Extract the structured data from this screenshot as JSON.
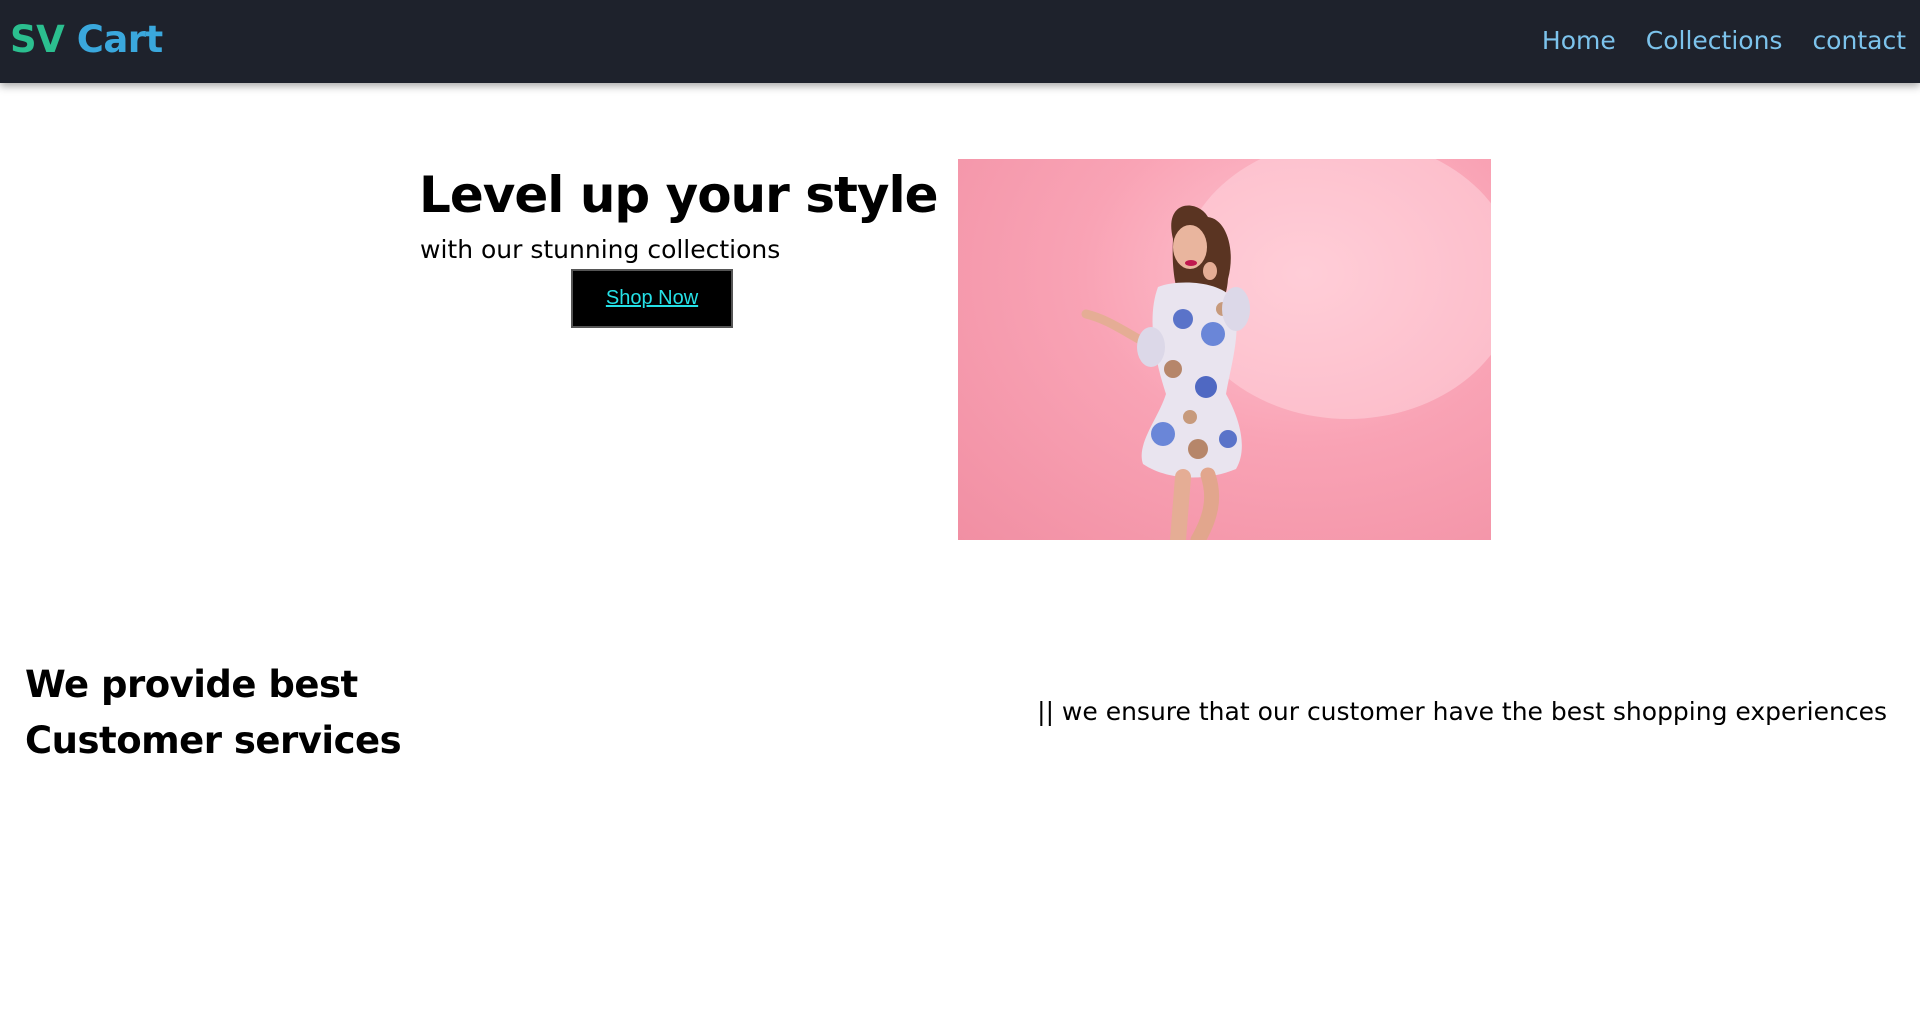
{
  "navbar": {
    "brand_part1": "SV",
    "brand_part2": "Cart",
    "links": [
      {
        "label": "Home"
      },
      {
        "label": "Collections"
      },
      {
        "label": "contact"
      }
    ],
    "background_color": "#1e222c",
    "link_color": "#7cc3ec"
  },
  "hero": {
    "title": "Level up your style",
    "subtitle": "with our stunning collections",
    "button_label": "Shop Now",
    "image_alt": "model in floral dress on pink background"
  },
  "services": {
    "heading_line1": "We provide best",
    "heading_line2": "Customer services",
    "text": "|| we ensure that our customer have the best shopping experiences"
  },
  "colors": {
    "brand_green": "#2bbf8f",
    "brand_blue": "#3aa8dd",
    "button_text": "#25e0e6",
    "hero_pink": "#f9a3b5"
  }
}
